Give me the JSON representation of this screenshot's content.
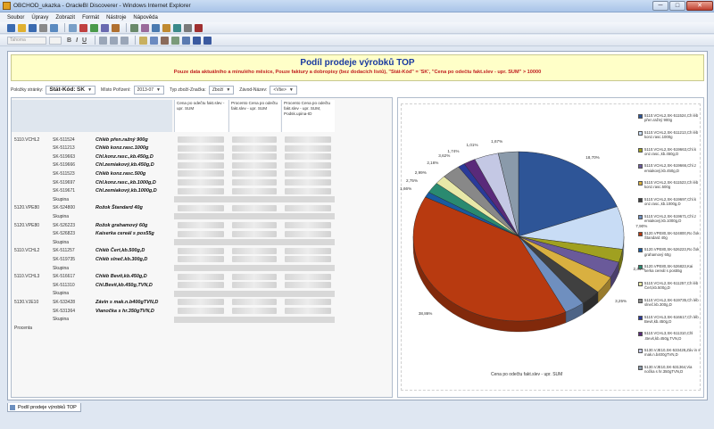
{
  "window": {
    "title": "OBCHOD_ukazka - OracleBI Discoverer - Windows Internet Explorer",
    "min": "─",
    "max": "□",
    "close": "✕"
  },
  "menu": [
    "Soubor",
    "Úpravy",
    "Zobrazit",
    "Formát",
    "Nástroje",
    "Nápověda"
  ],
  "toolbar2": {
    "font_placeholder": "Tahoma",
    "bold": "B",
    "italic": "I",
    "underline": "U"
  },
  "banner": {
    "title": "Podíl prodeje výrobků TOP",
    "subtitle": "Pouze data aktuálního a minulého měsíce, Pouze faktury a dobropisy (bez dodacích listů), \"Stát-Kód\" = 'SK', \"Cena po odečtu fakt.slev - upr. SUM\" > 10000"
  },
  "page_items": {
    "label": "Položky stránky:",
    "stat_label": "Stát-Kód:",
    "stat_value": "SK",
    "misto_label": "Místo Pořízení:",
    "misto_value": "2013-07",
    "typ_label": "Typ zboží-Značka:",
    "typ_value": "Zboží",
    "zavod_label": "Závod-Název:",
    "zavod_value": "<Vše>"
  },
  "table": {
    "headers": [
      "Cena po odečtu fakt.slev - upr. SUM",
      "Procento Cena po odečtu fakt.slev - upr. SUM",
      "Procento Cena po odečtu fakt.slev - upr. SUM, Podsk.upina-ID"
    ],
    "rows": [
      {
        "g": "5110.VCHL2",
        "sk": "SK-511524",
        "p": "Chléb přen.ražný 900g"
      },
      {
        "g": "",
        "sk": "SK-511213",
        "p": "Chléb konz.rasc.1000g"
      },
      {
        "g": "",
        "sk": "SK-519663",
        "p": "Chl.konz.rasc.,kb.450g,D"
      },
      {
        "g": "",
        "sk": "SK-519666",
        "p": "Chl.zemiakový,kb.450g,D"
      },
      {
        "g": "",
        "sk": "SK-511523",
        "p": "Chléb konz.rasc.500g"
      },
      {
        "g": "",
        "sk": "SK-519697",
        "p": "Chl.konz.rasc.,kb.1000g,D"
      },
      {
        "g": "",
        "sk": "SK-519671",
        "p": "Chl.zemiakový,kb.1000g,D"
      },
      {
        "g": "",
        "sk": "Skupina",
        "p": ""
      },
      {
        "g": "5120.VPE80",
        "sk": "SK-524800",
        "p": "Rožok Štandard 40g"
      },
      {
        "g": "",
        "sk": "Skupina",
        "p": ""
      },
      {
        "g": "5120.VPE80",
        "sk": "SK-526223",
        "p": "Rožok grahamový 60g"
      },
      {
        "g": "",
        "sk": "SK-526823",
        "p": "Kaiserka cereál s pos55g"
      },
      {
        "g": "",
        "sk": "Skupina",
        "p": ""
      },
      {
        "g": "5110.VCHL2",
        "sk": "SK-511257",
        "p": "Chléb Čert,kb.500g,D"
      },
      {
        "g": "",
        "sk": "SK-519735",
        "p": "Chléb slneč.kb.300g,D"
      },
      {
        "g": "",
        "sk": "Skupina",
        "p": ""
      },
      {
        "g": "5110.VCHL3",
        "sk": "SK-516617",
        "p": "Chléb Bevit,kb.450g,D"
      },
      {
        "g": "",
        "sk": "SK-511310",
        "p": "Chl.Bevit,kb.450g,TVN,D"
      },
      {
        "g": "",
        "sk": "Skupina",
        "p": ""
      },
      {
        "g": "5130.VJE10",
        "sk": "SK-533428",
        "p": "Závin s mak.n.b400gTVN,D"
      },
      {
        "g": "",
        "sk": "SK-531364",
        "p": "Vianočka s hr.350gTVN,D"
      },
      {
        "g": "",
        "sk": "Skupina",
        "p": ""
      },
      {
        "g": "Procenta",
        "sk": "",
        "p": ""
      }
    ]
  },
  "chart_data": {
    "type": "pie",
    "title": "",
    "xlabel": "Cena po odečtu fakt.slev - upr. SUM",
    "legend_position": "right",
    "categories": [
      "5110.VCHL2, SK-511524, Chléb přen.ražný 900g",
      "5110.VCHL2, SK-511213, Chléb konz.rasc.1000g",
      "5110.VCHL2, SK-519663, Chl.konz.rasc.,kb. 450g,D",
      "5110.VCHL2, SK-519666, Chl.zemiakový,kb.450g,D",
      "5110.VCHL2, SK-511523, Chléb konz.rasc.500g",
      "5110.VCHL2, SK-519697, Chl.konz.rasc.,kb.1000g,D",
      "5110.VCHL2, SK-519671, Chl.zemiakový,kb.1000g,D",
      "5120.VPE80, SK-524800, Rožok Štandard 40g",
      "5120.VPE80, SK-526223, Rožok grahamový 60g",
      "5120.VPE80, SK-526823, Kaiserka cereál s pos55g",
      "5110.VCHL2, SK-511257, Chléb Čert,kb.500g,D",
      "5110.VCHL2, SK-519735, Chléb slneč.kb.300g,D",
      "5110.VCHL3, SK-516617, Chléb Bevit,kb.450g,D",
      "5110.VCHL3, SK-511310, Chl.Bevit,kb.450g,TVN,D",
      "5130.VJE10, SK-533428, Závin s mak.n.b400gTVN,D",
      "5130.VJE10, SK-531364, Vianočka s hr.350gTVN,D"
    ],
    "legend_short": [
      "5110.VCHL2,SK-511524,Ch léb přen.ražný 900g",
      "5110.VCHL2,SK-511213,Ch léb konz.rasc.1000g",
      "5110.VCHL2,SK-519663,Chl.k onz.rasc.,kb.450g,D",
      "5110.VCHL2,SK-519666,Chl.z emiakový,kb.450g,D",
      "5110.VCHL2,SK-511523,Ch léb konz.rasc.500g",
      "5110.VCHL2,SK-519697,Chl.k onz.rasc.,kb.1000g,D",
      "5110.VCHL2,SK-519671,Chl.z emiakový,kb.1000g,D",
      "5120.VPE80,SK-524800,Ro žok Štandard 40g",
      "5120.VPE80,SK-526223,Ro žok grahamový 60g",
      "5120.VPE80,SK-526823,Kai serka cereál s pos55g",
      "5110.VCHL2,SK-511257,Ch léb Čert,kb.500g,D",
      "5110.VCHL2,SK-519735,Ch léb slneč.kb.300g,D",
      "5110.VCHL3,SK-516617,Ch léb Bevit,kb.450g,D",
      "5110.VCHL3,SK-511310,Chl .Bevit,kb.450g,TVN,D",
      "5130.VJE10,SK-533428,Záv in s mak.n.b400gTVN,D",
      "5130.VJE10,SK-531364,Via nočka s hr.350gTVN,D"
    ],
    "values": [
      18.7,
      7.9,
      2.44,
      3.0,
      3.25,
      3.0,
      3.0,
      38.86,
      1.0,
      2.0,
      1.66,
      2.75,
      1.01,
      1.74,
      3.62,
      3.0
    ],
    "labels": [
      "18,70%",
      "7,90%",
      "2,44%",
      "",
      "3,25%",
      "",
      "",
      "38,86%",
      "1,66%",
      "2,75%",
      "2,99%",
      "2,16%",
      "3,62%",
      "1,74%",
      "1,01%",
      "1,67%"
    ],
    "colors": [
      "#2e5597",
      "#c8dcf5",
      "#a0a020",
      "#6a5a9a",
      "#d9b040",
      "#404040",
      "#6f8fbf",
      "#b83a10",
      "#1a5aa0",
      "#2a8a70",
      "#e8e8a8",
      "#888888",
      "#2a3a9a",
      "#5a2a7a",
      "#c4c8e4",
      "#8a9aaa"
    ]
  },
  "sheet_tab": "Podíl prodeje výrobků TOP"
}
